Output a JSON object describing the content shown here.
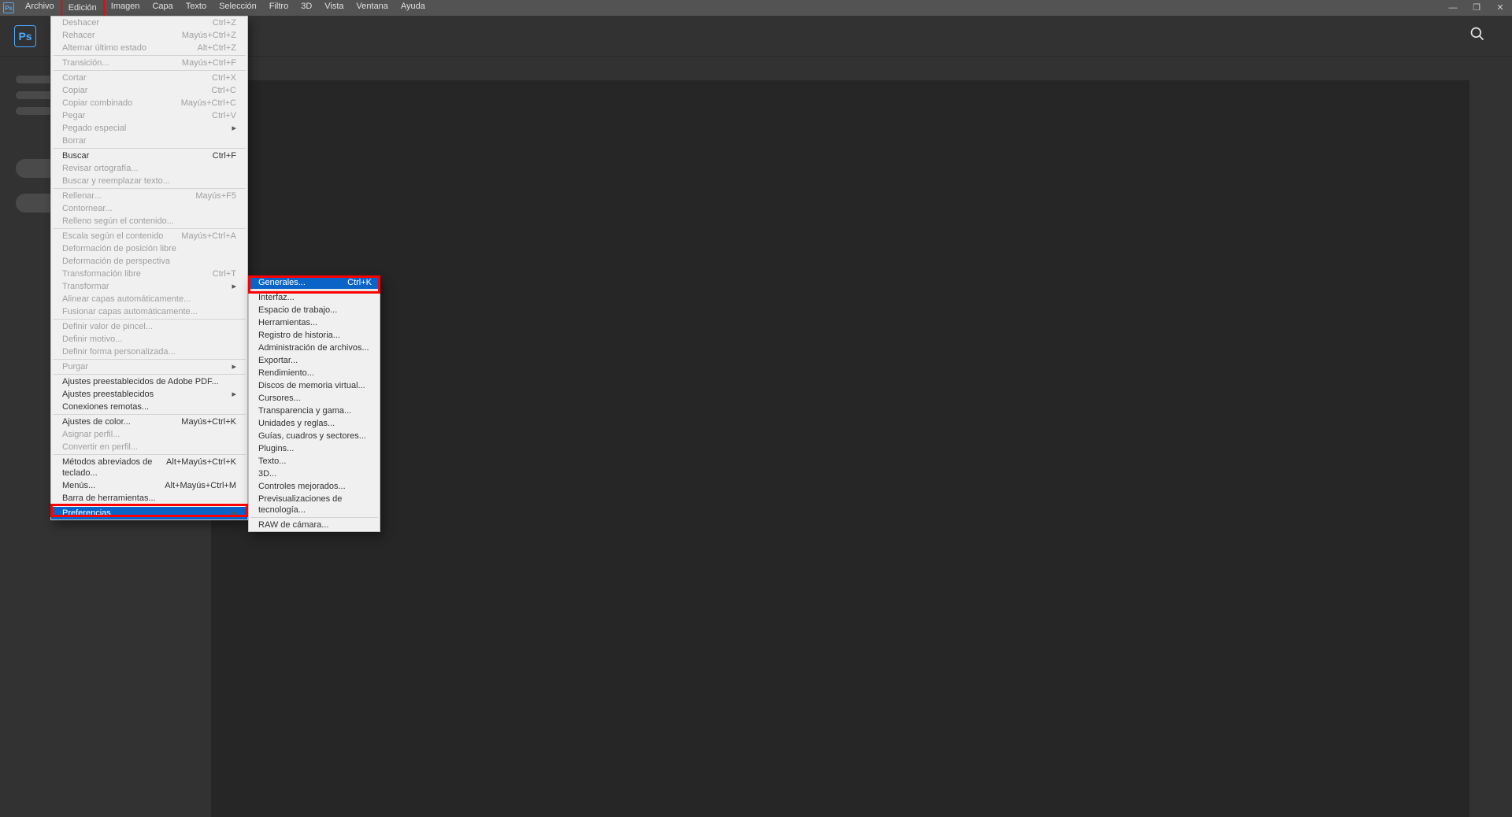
{
  "menubar": {
    "badge": "Ps",
    "items": [
      "Archivo",
      "Edición",
      "Imagen",
      "Capa",
      "Texto",
      "Selección",
      "Filtro",
      "3D",
      "Vista",
      "Ventana",
      "Ayuda"
    ],
    "active_index": 1
  },
  "appbar": {
    "logo": "Ps"
  },
  "edit_menu": {
    "groups": [
      [
        {
          "label": "Deshacer",
          "shortcut": "Ctrl+Z",
          "disabled": true
        },
        {
          "label": "Rehacer",
          "shortcut": "Mayús+Ctrl+Z",
          "disabled": true
        },
        {
          "label": "Alternar último estado",
          "shortcut": "Alt+Ctrl+Z",
          "disabled": true
        }
      ],
      [
        {
          "label": "Transición...",
          "shortcut": "Mayús+Ctrl+F",
          "disabled": true
        }
      ],
      [
        {
          "label": "Cortar",
          "shortcut": "Ctrl+X",
          "disabled": true
        },
        {
          "label": "Copiar",
          "shortcut": "Ctrl+C",
          "disabled": true
        },
        {
          "label": "Copiar combinado",
          "shortcut": "Mayús+Ctrl+C",
          "disabled": true
        },
        {
          "label": "Pegar",
          "shortcut": "Ctrl+V",
          "disabled": true
        },
        {
          "label": "Pegado especial",
          "submenu": true,
          "disabled": true
        },
        {
          "label": "Borrar",
          "disabled": true
        }
      ],
      [
        {
          "label": "Buscar",
          "shortcut": "Ctrl+F"
        },
        {
          "label": "Revisar ortografía...",
          "disabled": true
        },
        {
          "label": "Buscar y reemplazar texto...",
          "disabled": true
        }
      ],
      [
        {
          "label": "Rellenar...",
          "shortcut": "Mayús+F5",
          "disabled": true
        },
        {
          "label": "Contornear...",
          "disabled": true
        },
        {
          "label": "Relleno según el contenido...",
          "disabled": true
        }
      ],
      [
        {
          "label": "Escala según el contenido",
          "shortcut": "Mayús+Ctrl+A",
          "disabled": true
        },
        {
          "label": "Deformación de posición libre",
          "disabled": true
        },
        {
          "label": "Deformación de perspectiva",
          "disabled": true
        },
        {
          "label": "Transformación libre",
          "shortcut": "Ctrl+T",
          "disabled": true
        },
        {
          "label": "Transformar",
          "submenu": true,
          "disabled": true
        },
        {
          "label": "Alinear capas automáticamente...",
          "disabled": true
        },
        {
          "label": "Fusionar capas automáticamente...",
          "disabled": true
        }
      ],
      [
        {
          "label": "Definir valor de pincel...",
          "disabled": true
        },
        {
          "label": "Definir motivo...",
          "disabled": true
        },
        {
          "label": "Definir forma personalizada...",
          "disabled": true
        }
      ],
      [
        {
          "label": "Purgar",
          "submenu": true,
          "disabled": true
        }
      ],
      [
        {
          "label": "Ajustes preestablecidos de Adobe PDF..."
        },
        {
          "label": "Ajustes preestablecidos",
          "submenu": true
        },
        {
          "label": "Conexiones remotas..."
        }
      ],
      [
        {
          "label": "Ajustes de color...",
          "shortcut": "Mayús+Ctrl+K"
        },
        {
          "label": "Asignar perfil...",
          "disabled": true
        },
        {
          "label": "Convertir en perfil...",
          "disabled": true
        }
      ],
      [
        {
          "label": "Métodos abreviados de teclado...",
          "shortcut": "Alt+Mayús+Ctrl+K"
        },
        {
          "label": "Menús...",
          "shortcut": "Alt+Mayús+Ctrl+M"
        },
        {
          "label": "Barra de herramientas..."
        }
      ],
      [
        {
          "label": "Preferencias",
          "submenu": true,
          "highlighted": true
        }
      ]
    ]
  },
  "preferences_submenu": {
    "groups": [
      [
        {
          "label": "Generales...",
          "shortcut": "Ctrl+K",
          "highlighted": true
        }
      ],
      [
        {
          "label": "Interfaz..."
        },
        {
          "label": "Espacio de trabajo..."
        },
        {
          "label": "Herramientas..."
        },
        {
          "label": "Registro de historia..."
        },
        {
          "label": "Administración de archivos..."
        },
        {
          "label": "Exportar..."
        },
        {
          "label": "Rendimiento..."
        },
        {
          "label": "Discos de memoria virtual..."
        },
        {
          "label": "Cursores..."
        },
        {
          "label": "Transparencia y gama..."
        },
        {
          "label": "Unidades y reglas..."
        },
        {
          "label": "Guías, cuadros y sectores..."
        },
        {
          "label": "Plugins..."
        },
        {
          "label": "Texto..."
        },
        {
          "label": "3D..."
        },
        {
          "label": "Controles mejorados..."
        },
        {
          "label": "Previsualizaciones de tecnología..."
        }
      ],
      [
        {
          "label": "RAW de cámara..."
        }
      ]
    ]
  }
}
